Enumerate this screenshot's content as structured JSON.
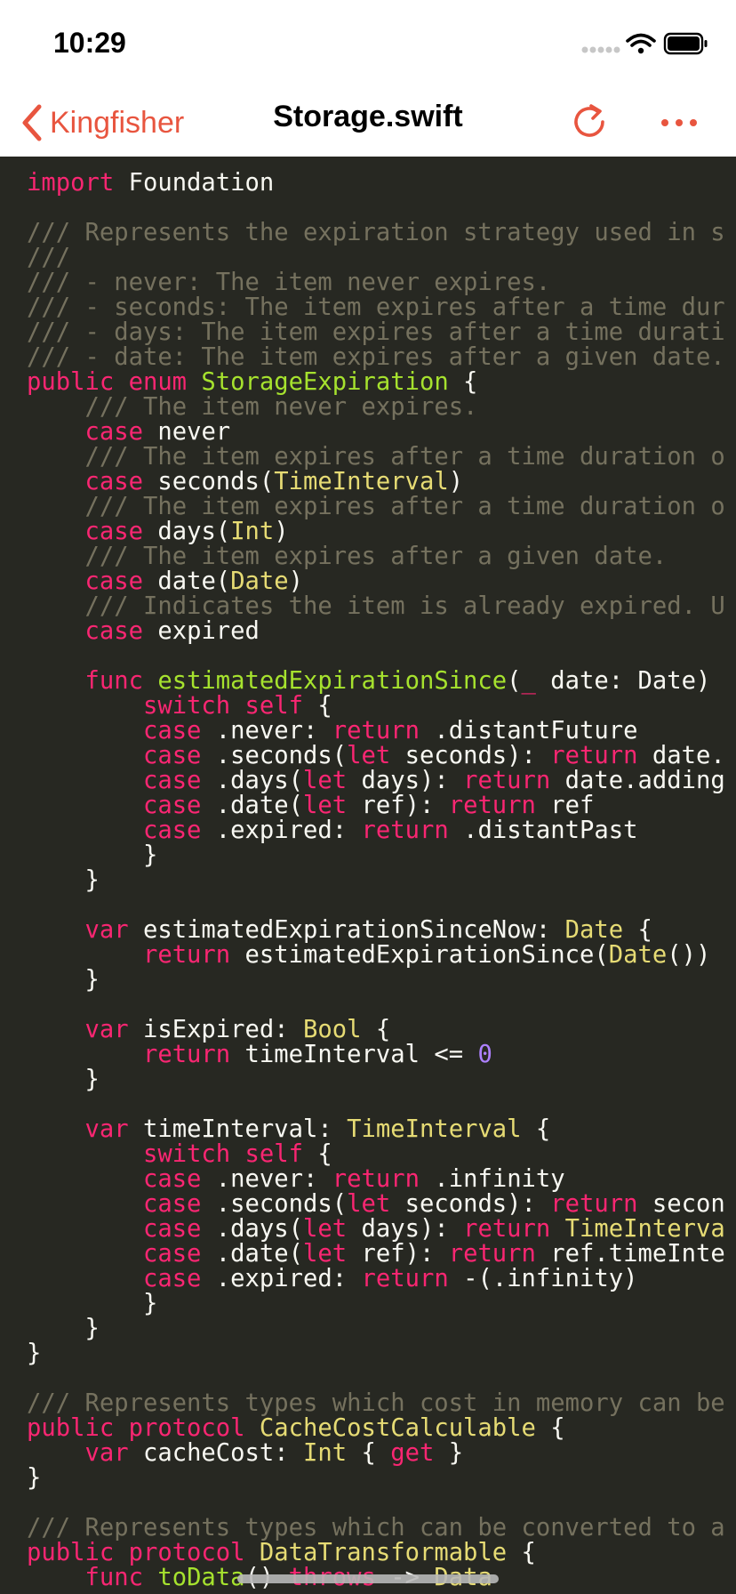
{
  "status_bar": {
    "time": "10:29",
    "icons": [
      "signal-dots-icon",
      "wifi-icon",
      "battery-icon"
    ]
  },
  "nav": {
    "back_label": "Kingfisher",
    "title": "Storage.swift",
    "refresh_icon": "refresh-icon",
    "more_icon": "more-icon"
  },
  "colors": {
    "accent": "#e8553f",
    "background": "#272822",
    "keyword": "#f92672",
    "comment": "#75715e",
    "type": "#e6db74",
    "function": "#a6e22e",
    "number": "#ae81ff",
    "plain": "#f8f8f2"
  },
  "code_lines": [
    [
      [
        "kw",
        "import"
      ],
      [
        "pl",
        " Foundation"
      ]
    ],
    [],
    [
      [
        "cm",
        "/// Represents the expiration strategy used in s"
      ]
    ],
    [
      [
        "cm",
        "///"
      ]
    ],
    [
      [
        "cm",
        "/// - never: The item never expires."
      ]
    ],
    [
      [
        "cm",
        "/// - seconds: The item expires after a time dur"
      ]
    ],
    [
      [
        "cm",
        "/// - days: The item expires after a time durati"
      ]
    ],
    [
      [
        "cm",
        "/// - date: The item expires after a given date."
      ]
    ],
    [
      [
        "kw",
        "public enum "
      ],
      [
        "fn",
        "StorageExpiration"
      ],
      [
        "pl",
        " {"
      ]
    ],
    [
      [
        "pl",
        "    "
      ],
      [
        "cm",
        "/// The item never expires."
      ]
    ],
    [
      [
        "pl",
        "    "
      ],
      [
        "kw",
        "case"
      ],
      [
        "pl",
        " never"
      ]
    ],
    [
      [
        "pl",
        "    "
      ],
      [
        "cm",
        "/// The item expires after a time duration o"
      ]
    ],
    [
      [
        "pl",
        "    "
      ],
      [
        "kw",
        "case"
      ],
      [
        "pl",
        " seconds("
      ],
      [
        "ty",
        "TimeInterval"
      ],
      [
        "pl",
        ")"
      ]
    ],
    [
      [
        "pl",
        "    "
      ],
      [
        "cm",
        "/// The item expires after a time duration o"
      ]
    ],
    [
      [
        "pl",
        "    "
      ],
      [
        "kw",
        "case"
      ],
      [
        "pl",
        " days("
      ],
      [
        "ty",
        "Int"
      ],
      [
        "pl",
        ")"
      ]
    ],
    [
      [
        "pl",
        "    "
      ],
      [
        "cm",
        "/// The item expires after a given date."
      ]
    ],
    [
      [
        "pl",
        "    "
      ],
      [
        "kw",
        "case"
      ],
      [
        "pl",
        " date("
      ],
      [
        "ty",
        "Date"
      ],
      [
        "pl",
        ")"
      ]
    ],
    [
      [
        "pl",
        "    "
      ],
      [
        "cm",
        "/// Indicates the item is already expired. U"
      ]
    ],
    [
      [
        "pl",
        "    "
      ],
      [
        "kw",
        "case"
      ],
      [
        "pl",
        " expired"
      ]
    ],
    [],
    [
      [
        "pl",
        "    "
      ],
      [
        "kw",
        "func "
      ],
      [
        "fn",
        "estimatedExpirationSince"
      ],
      [
        "pl",
        "("
      ],
      [
        "kw",
        "_"
      ],
      [
        "pl",
        " date: Date)"
      ]
    ],
    [
      [
        "pl",
        "        "
      ],
      [
        "kw",
        "switch self"
      ],
      [
        "pl",
        " {"
      ]
    ],
    [
      [
        "pl",
        "        "
      ],
      [
        "kw",
        "case"
      ],
      [
        "pl",
        " .never: "
      ],
      [
        "kw",
        "return"
      ],
      [
        "pl",
        " .distantFuture"
      ]
    ],
    [
      [
        "pl",
        "        "
      ],
      [
        "kw",
        "case"
      ],
      [
        "pl",
        " .seconds("
      ],
      [
        "kw",
        "let"
      ],
      [
        "pl",
        " seconds): "
      ],
      [
        "kw",
        "return"
      ],
      [
        "pl",
        " date."
      ]
    ],
    [
      [
        "pl",
        "        "
      ],
      [
        "kw",
        "case"
      ],
      [
        "pl",
        " .days("
      ],
      [
        "kw",
        "let"
      ],
      [
        "pl",
        " days): "
      ],
      [
        "kw",
        "return"
      ],
      [
        "pl",
        " date.adding"
      ]
    ],
    [
      [
        "pl",
        "        "
      ],
      [
        "kw",
        "case"
      ],
      [
        "pl",
        " .date("
      ],
      [
        "kw",
        "let"
      ],
      [
        "pl",
        " ref): "
      ],
      [
        "kw",
        "return"
      ],
      [
        "pl",
        " ref"
      ]
    ],
    [
      [
        "pl",
        "        "
      ],
      [
        "kw",
        "case"
      ],
      [
        "pl",
        " .expired: "
      ],
      [
        "kw",
        "return"
      ],
      [
        "pl",
        " .distantPast"
      ]
    ],
    [
      [
        "pl",
        "        }"
      ]
    ],
    [
      [
        "pl",
        "    }"
      ]
    ],
    [],
    [
      [
        "pl",
        "    "
      ],
      [
        "kw",
        "var"
      ],
      [
        "pl",
        " estimatedExpirationSinceNow: "
      ],
      [
        "ty",
        "Date"
      ],
      [
        "pl",
        " {"
      ]
    ],
    [
      [
        "pl",
        "        "
      ],
      [
        "kw",
        "return"
      ],
      [
        "pl",
        " estimatedExpirationSince("
      ],
      [
        "ty",
        "Date"
      ],
      [
        "pl",
        "())"
      ]
    ],
    [
      [
        "pl",
        "    }"
      ]
    ],
    [],
    [
      [
        "pl",
        "    "
      ],
      [
        "kw",
        "var"
      ],
      [
        "pl",
        " isExpired: "
      ],
      [
        "ty",
        "Bool"
      ],
      [
        "pl",
        " {"
      ]
    ],
    [
      [
        "pl",
        "        "
      ],
      [
        "kw",
        "return"
      ],
      [
        "pl",
        " timeInterval <= "
      ],
      [
        "nm",
        "0"
      ]
    ],
    [
      [
        "pl",
        "    }"
      ]
    ],
    [],
    [
      [
        "pl",
        "    "
      ],
      [
        "kw",
        "var"
      ],
      [
        "pl",
        " timeInterval: "
      ],
      [
        "ty",
        "TimeInterval"
      ],
      [
        "pl",
        " {"
      ]
    ],
    [
      [
        "pl",
        "        "
      ],
      [
        "kw",
        "switch self"
      ],
      [
        "pl",
        " {"
      ]
    ],
    [
      [
        "pl",
        "        "
      ],
      [
        "kw",
        "case"
      ],
      [
        "pl",
        " .never: "
      ],
      [
        "kw",
        "return"
      ],
      [
        "pl",
        " .infinity"
      ]
    ],
    [
      [
        "pl",
        "        "
      ],
      [
        "kw",
        "case"
      ],
      [
        "pl",
        " .seconds("
      ],
      [
        "kw",
        "let"
      ],
      [
        "pl",
        " seconds): "
      ],
      [
        "kw",
        "return"
      ],
      [
        "pl",
        " secon"
      ]
    ],
    [
      [
        "pl",
        "        "
      ],
      [
        "kw",
        "case"
      ],
      [
        "pl",
        " .days("
      ],
      [
        "kw",
        "let"
      ],
      [
        "pl",
        " days): "
      ],
      [
        "kw",
        "return"
      ],
      [
        "ty",
        " TimeInterva"
      ]
    ],
    [
      [
        "pl",
        "        "
      ],
      [
        "kw",
        "case"
      ],
      [
        "pl",
        " .date("
      ],
      [
        "kw",
        "let"
      ],
      [
        "pl",
        " ref): "
      ],
      [
        "kw",
        "return"
      ],
      [
        "pl",
        " ref.timeInte"
      ]
    ],
    [
      [
        "pl",
        "        "
      ],
      [
        "kw",
        "case"
      ],
      [
        "pl",
        " .expired: "
      ],
      [
        "kw",
        "return"
      ],
      [
        "pl",
        " -(.infinity)"
      ]
    ],
    [
      [
        "pl",
        "        }"
      ]
    ],
    [
      [
        "pl",
        "    }"
      ]
    ],
    [
      [
        "pl",
        "}"
      ]
    ],
    [],
    [
      [
        "cm",
        "/// Represents types which cost in memory can be"
      ]
    ],
    [
      [
        "kw",
        "public protocol "
      ],
      [
        "ty",
        "CacheCostCalculable"
      ],
      [
        "pl",
        " {"
      ]
    ],
    [
      [
        "pl",
        "    "
      ],
      [
        "kw",
        "var"
      ],
      [
        "pl",
        " cacheCost: "
      ],
      [
        "ty",
        "Int"
      ],
      [
        "pl",
        " { "
      ],
      [
        "kw",
        "get"
      ],
      [
        "pl",
        " }"
      ]
    ],
    [
      [
        "pl",
        "}"
      ]
    ],
    [],
    [
      [
        "cm",
        "/// Represents types which can be converted to a"
      ]
    ],
    [
      [
        "kw",
        "public protocol "
      ],
      [
        "ty",
        "DataTransformable"
      ],
      [
        "pl",
        " {"
      ]
    ],
    [
      [
        "pl",
        "    "
      ],
      [
        "kw",
        "func "
      ],
      [
        "fn",
        "toData"
      ],
      [
        "pl",
        "() "
      ],
      [
        "kw",
        "throws"
      ],
      [
        "pl",
        " -> "
      ],
      [
        "ty",
        "Data"
      ]
    ]
  ]
}
